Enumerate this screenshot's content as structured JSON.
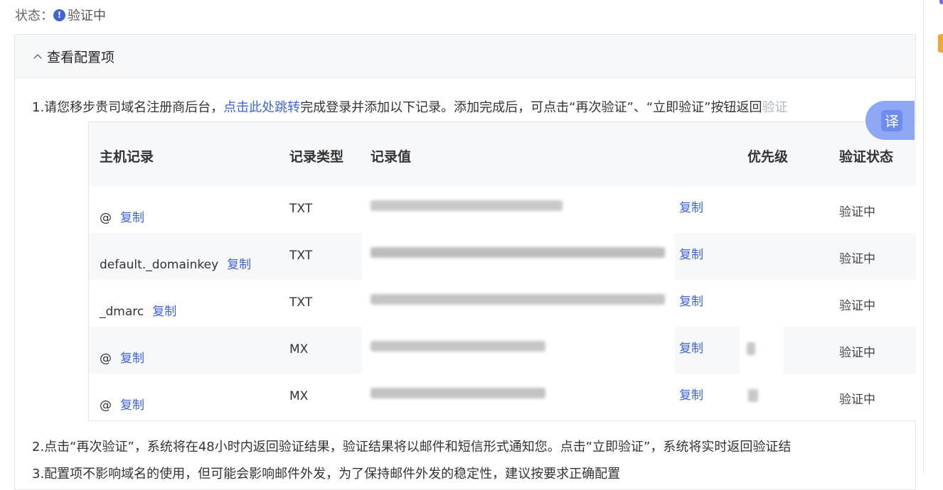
{
  "status": {
    "label": "状态：",
    "value": "验证中",
    "icon": "exclamation-circle-icon"
  },
  "panel": {
    "title": "查看配置项"
  },
  "steps": {
    "step1_prefix": "1.请您移步贵司域名注册商后台，",
    "step1_link": "点击此处跳转",
    "step1_suffix": "完成登录并添加以下记录。添加完成后，可点击“再次验证”、“立即验证”按钮返回",
    "step1_tail": "验证",
    "step2": "2.点击“再次验证”，系统将在48小时内返回验证结果，验证结果将以邮件和短信形式通知您。点击“立即验证”，系统将实时返回验证结",
    "step3": "3.配置项不影响域名的使用，但可能会影响邮件外发，为了保持邮件外发的稳定性，建议按要求正确配置"
  },
  "table": {
    "headers": {
      "host": "主机记录",
      "type": "记录类型",
      "value": "记录值",
      "priority": "优先级",
      "status": "验证状态"
    },
    "copy_label": "复制",
    "rows": [
      {
        "host": "@",
        "type": "TXT",
        "status": "验证中"
      },
      {
        "host": "default._domainkey",
        "type": "TXT",
        "status": "验证中"
      },
      {
        "host": "_dmarc",
        "type": "TXT",
        "status": "验证中"
      },
      {
        "host": "@",
        "type": "MX",
        "status": "验证中"
      },
      {
        "host": "@",
        "type": "MX",
        "status": "验证中"
      }
    ]
  },
  "translate": {
    "glyph": "译"
  },
  "colors": {
    "accent": "#3e63dd",
    "header_bg": "#f7f8fa",
    "border": "#e6e6e6"
  }
}
